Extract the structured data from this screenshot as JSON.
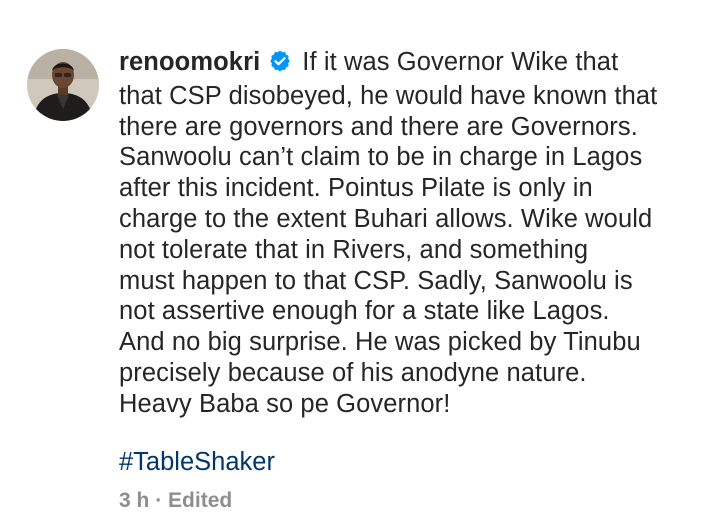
{
  "comment": {
    "username": "renoomokri",
    "verified_icon": "verified-badge-icon",
    "text_line_1": "If it was Governor Wike that",
    "text_rest": "that CSP disobeyed, he would have known that\nthere are governors and there are Governors.\nSanwoolu can’t claim to be in charge in Lagos\nafter this incident. Pointus Pilate is only in\ncharge to the extent Buhari allows. Wike would\nnot tolerate that in Rivers, and something\nmust happen to that CSP. Sadly, Sanwoolu is\nnot assertive enough for a state like Lagos.\nAnd no big surprise. He was picked by Tinubu\nprecisely because of his anodyne nature.\nHeavy Baba so pe Governor!",
    "hashtag": "#TableShaker",
    "time": "3 h",
    "separator": "·",
    "edited_label": "Edited"
  },
  "colors": {
    "text": "#262626",
    "hashtag": "#00376b",
    "meta": "#8e8e8e",
    "verified": "#0095f6"
  }
}
